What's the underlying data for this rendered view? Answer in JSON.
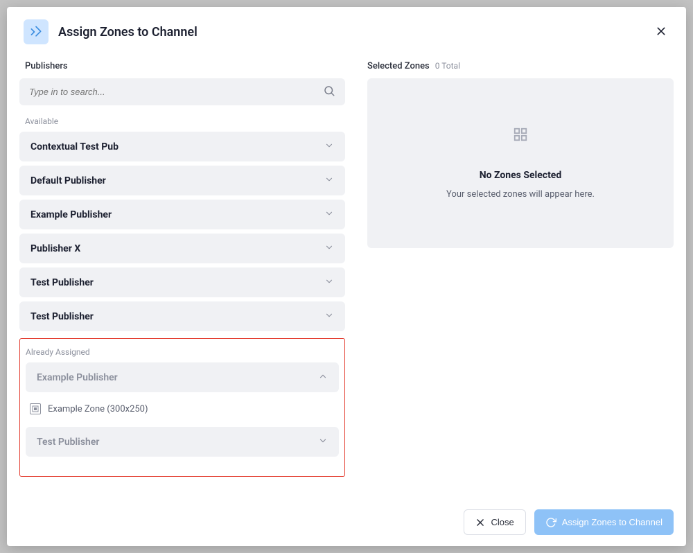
{
  "modal": {
    "title": "Assign Zones to Channel"
  },
  "left": {
    "publishers_label": "Publishers",
    "search_placeholder": "Type in to search...",
    "available_label": "Available",
    "already_assigned_label": "Already Assigned",
    "available": [
      "Contextual Test Pub",
      "Default Publisher",
      "Example Publisher",
      "Publisher X",
      "Test Publisher",
      "Test Publisher"
    ],
    "assigned": {
      "expanded_publisher": "Example Publisher",
      "expanded_zone": "Example Zone (300x250)",
      "collapsed_publisher": "Test Publisher"
    }
  },
  "right": {
    "title": "Selected Zones",
    "count_text": "0 Total",
    "empty_title": "No Zones Selected",
    "empty_subtitle": "Your selected zones will appear here."
  },
  "footer": {
    "close": "Close",
    "assign": "Assign Zones to Channel"
  }
}
